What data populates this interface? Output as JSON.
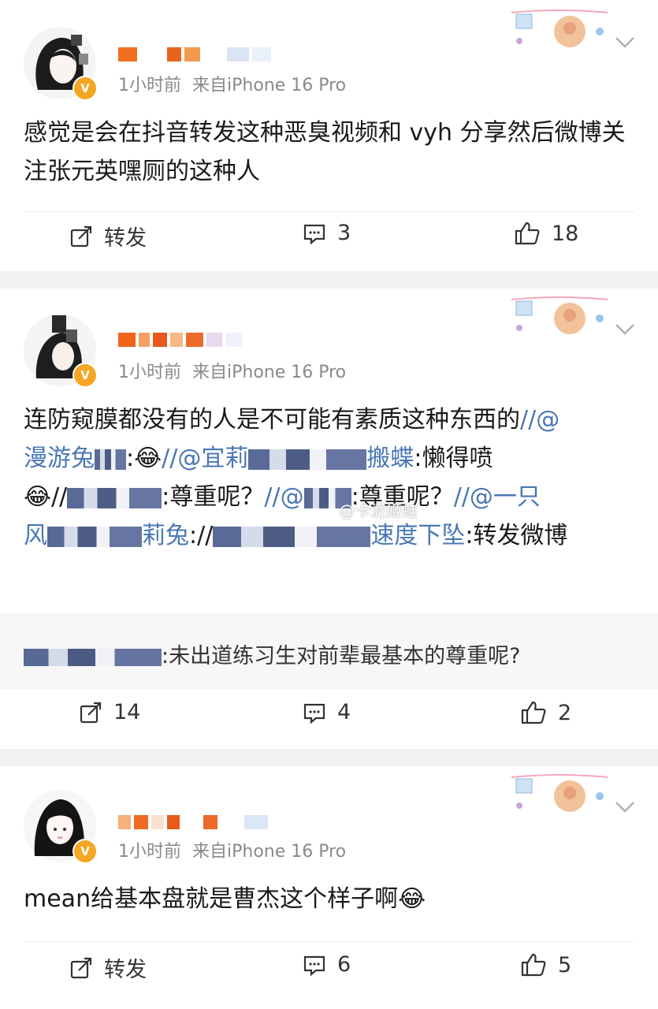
{
  "posts": [
    {
      "time": "1小时前",
      "source": "来自iPhone 16 Pro",
      "text": "感觉是会在抖音转发这种恶臭视频和 vyh 分享然后微博关注张元英嘿厕的这种人",
      "actions": {
        "repost": "转发",
        "comments": "3",
        "likes": "18"
      }
    },
    {
      "time": "1小时前",
      "source": "来自iPhone 16 Pro",
      "text_segments": [
        "连防窥膜都没有的人是不可能有素质这种东西的",
        "//@",
        "漫游兔",
        ":",
        "//@宜莉",
        "搬蝶",
        ":懒得喷",
        "//",
        ":尊重呢？",
        "//@",
        ":尊重呢？",
        "//@一只",
        "风",
        "莉兔",
        "://",
        "速度下坠",
        ":转发微博"
      ],
      "quote": ":未出道练习生对前辈最基本的尊重呢?",
      "actions": {
        "reposts": "14",
        "comments": "4",
        "likes": "2"
      }
    },
    {
      "time": "1小时前",
      "source": "来自iPhone 16 Pro",
      "text": "mean给基本盘就是曹杰这个样子啊",
      "actions": {
        "repost": "转发",
        "comments": "6",
        "likes": "5"
      }
    }
  ],
  "watermark": "@卡泥姬蛙",
  "colors": {
    "link": "#4a77b5",
    "badge": "#f5a623",
    "divider": "#f2f2f2"
  }
}
